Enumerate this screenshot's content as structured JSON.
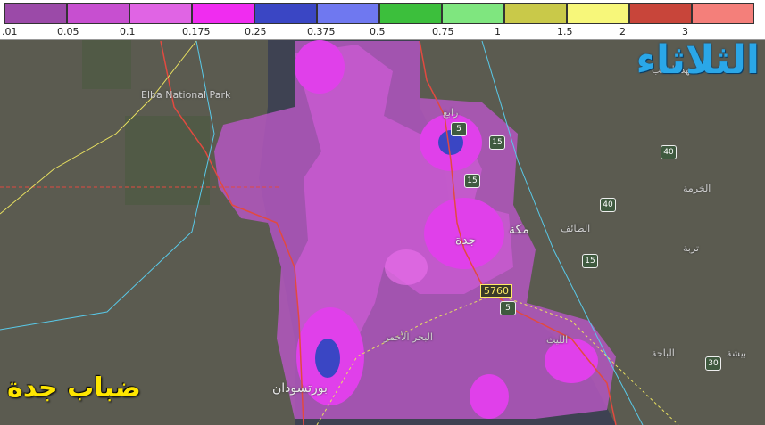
{
  "legend": {
    "colors": [
      "#9b4aa8",
      "#c74fd0",
      "#e064e4",
      "#f02cf0",
      "#3a46c4",
      "#6f78f0",
      "#3cbf3c",
      "#7fe67f",
      "#c9c949",
      "#f7f77a",
      "#c8453a",
      "#f47f7a"
    ],
    "ticks": [
      ".01",
      "0.05",
      "0.1",
      "0.175",
      "0.25",
      "0.375",
      "0.5",
      "0.75",
      "1",
      "1.5",
      "2",
      "3"
    ]
  },
  "overlay": {
    "title": "الثلاثاء",
    "caption": "ضباب جدة"
  },
  "places": {
    "elba_park": "Elba National Park",
    "jeddah": "جدة",
    "mecca": "مكة",
    "taif": "الطائف",
    "rabigh": "رابغ",
    "port_sudan": "بورتسودان",
    "red_sea": "البحر الأحمر",
    "al_lith": "الليث",
    "mahd": "مهد الذهب",
    "bisha": "بيشة",
    "baha": "الباحة",
    "khurma": "الخرمة",
    "turaba": "تربة",
    "elevation": "5760"
  },
  "routes": [
    "5",
    "15",
    "15",
    "40",
    "40",
    "15",
    "5",
    "30"
  ],
  "map_colors": {
    "land": "#5a5a52",
    "sea": "#3d4150",
    "fog_light": "#b455c0",
    "fog_mid": "#d55fd8",
    "fog_strong": "#ee3cef",
    "fog_core": "#3a46c4"
  }
}
